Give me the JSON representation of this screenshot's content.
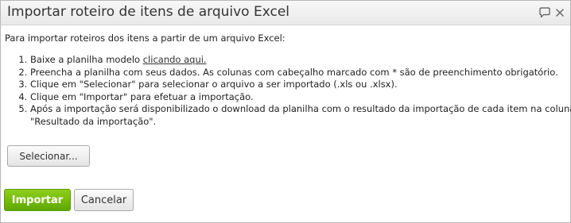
{
  "dialog": {
    "title": "Importar roteiro de itens de arquivo Excel",
    "title_icons": [
      "chat-bubble-icon",
      "close-icon"
    ]
  },
  "content": {
    "intro": "Para importar roteiros dos itens a partir de um arquivo Excel:",
    "step1_prefix": "Baixe a planilha modelo ",
    "step1_link": "clicando aqui.",
    "step2": "Preencha a planilha com seus dados. As colunas com cabeçalho marcado com * são de preenchimento obrigatório.",
    "step3": "Clique em \"Selecionar\" para selecionar o arquivo a ser importado (.xls ou .xlsx).",
    "step4": "Clique em \"Importar\" para efetuar a importação.",
    "step5_line1": "Após a importação será disponibilizado o download da planilha com o resultado da importação de cada item na coluna",
    "step5_line2": "\"Resultado da importação\"."
  },
  "buttons": {
    "select": "Selecionar...",
    "import": "Importar",
    "cancel": "Cancelar"
  },
  "colors": {
    "import_button": "#6db50f",
    "title_bar": "#efefef"
  }
}
